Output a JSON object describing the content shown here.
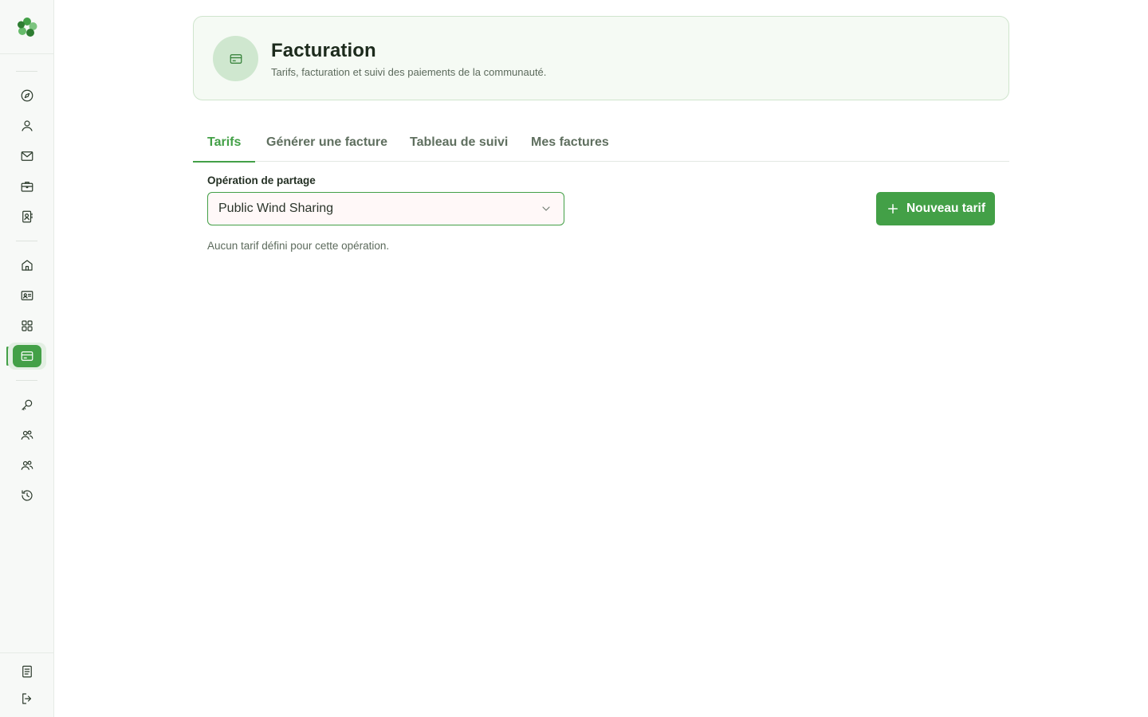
{
  "sidebar": {
    "nav_icons": [
      "compass-icon",
      "user-icon",
      "mail-icon",
      "briefcase-icon",
      "contacts-book-icon",
      "home-icon",
      "id-card-icon",
      "grid-icon",
      "billing-card-icon",
      "key-icon",
      "users-icon",
      "users-group-icon",
      "history-icon"
    ],
    "bottom_icons": [
      "document-icon",
      "logout-icon"
    ],
    "active_item": "billing-card-icon"
  },
  "header": {
    "title": "Facturation",
    "subtitle": "Tarifs, facturation et suivi des paiements de la communauté."
  },
  "tabs": [
    {
      "label": "Tarifs",
      "active": true
    },
    {
      "label": "Générer une facture",
      "active": false
    },
    {
      "label": "Tableau de suivi",
      "active": false
    },
    {
      "label": "Mes factures",
      "active": false
    }
  ],
  "form": {
    "operation_label": "Opération de partage",
    "operation_value": "Public Wind Sharing",
    "empty_message": "Aucun tarif défini pour cette opération."
  },
  "actions": {
    "new_tariff_label": "Nouveau tarif"
  },
  "colors": {
    "accent": "#43a047",
    "header_bg": "#f5faf4",
    "sidebar_bg": "#f7f9f7"
  }
}
